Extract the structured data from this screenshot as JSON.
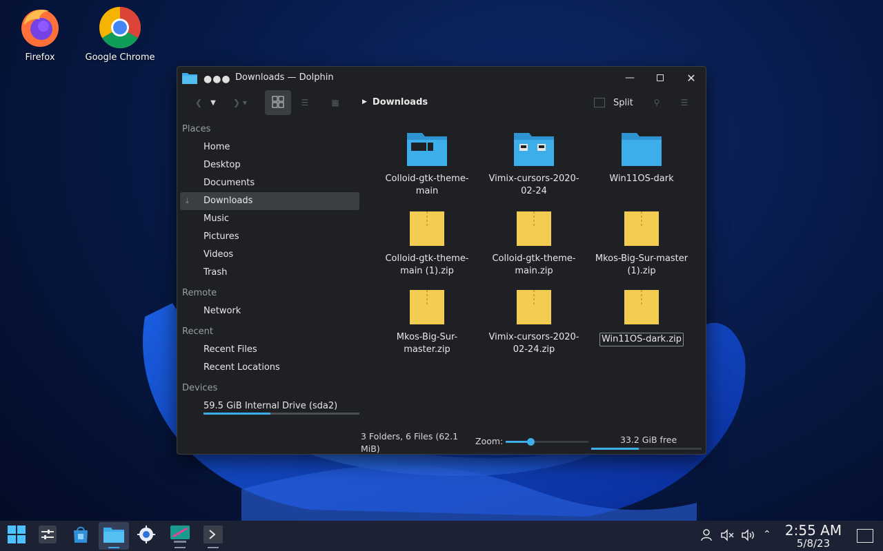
{
  "desktop": {
    "icons": [
      {
        "label": "Firefox"
      },
      {
        "label": "Google Chrome"
      }
    ]
  },
  "window": {
    "title": "Downloads — Dolphin",
    "title_dots": "●●●",
    "toolbar": {
      "breadcrumb": "Downloads",
      "split_label": "Split"
    }
  },
  "sidebar": {
    "places_header": "Places",
    "places": [
      {
        "label": "Home",
        "icon": "home-icon"
      },
      {
        "label": "Desktop",
        "icon": "desktop-icon"
      },
      {
        "label": "Documents",
        "icon": "documents-icon"
      },
      {
        "label": "Downloads",
        "icon": "download-icon"
      },
      {
        "label": "Music",
        "icon": "music-icon"
      },
      {
        "label": "Pictures",
        "icon": "pictures-icon"
      },
      {
        "label": "Videos",
        "icon": "videos-icon"
      },
      {
        "label": "Trash",
        "icon": "trash-icon"
      }
    ],
    "remote_header": "Remote",
    "remote": [
      {
        "label": "Network"
      }
    ],
    "recent_header": "Recent",
    "recent": [
      {
        "label": "Recent Files"
      },
      {
        "label": "Recent Locations"
      }
    ],
    "devices_header": "Devices",
    "devices": [
      {
        "label": "59.5 GiB Internal Drive (sda2)",
        "used_fraction": 0.43
      }
    ]
  },
  "files": [
    {
      "name": "Colloid-gtk-theme-main",
      "kind": "folder"
    },
    {
      "name": "Vimix-cursors-2020-02-24",
      "kind": "folder"
    },
    {
      "name": "Win11OS-dark",
      "kind": "folder"
    },
    {
      "name": "Colloid-gtk-theme-main (1).zip",
      "kind": "zip"
    },
    {
      "name": "Colloid-gtk-theme-main.zip",
      "kind": "zip"
    },
    {
      "name": "Mkos-Big-Sur-master (1).zip",
      "kind": "zip"
    },
    {
      "name": "Mkos-Big-Sur-master.zip",
      "kind": "zip"
    },
    {
      "name": "Vimix-cursors-2020-02-24.zip",
      "kind": "zip"
    },
    {
      "name": "Win11OS-dark.zip",
      "kind": "zip"
    }
  ],
  "statusbar": {
    "summary": "3 Folders, 6 Files (62.1 MiB)",
    "zoom_label": "Zoom:",
    "zoom_fraction": 0.3,
    "free_label": "33.2 GiB free",
    "used_fraction": 0.43
  },
  "taskbar": {
    "time": "2:55 AM",
    "date": "5/8/23"
  },
  "colors": {
    "accent": "#3daee9",
    "folder": "#3daee9",
    "zip": "#f3cc52"
  }
}
